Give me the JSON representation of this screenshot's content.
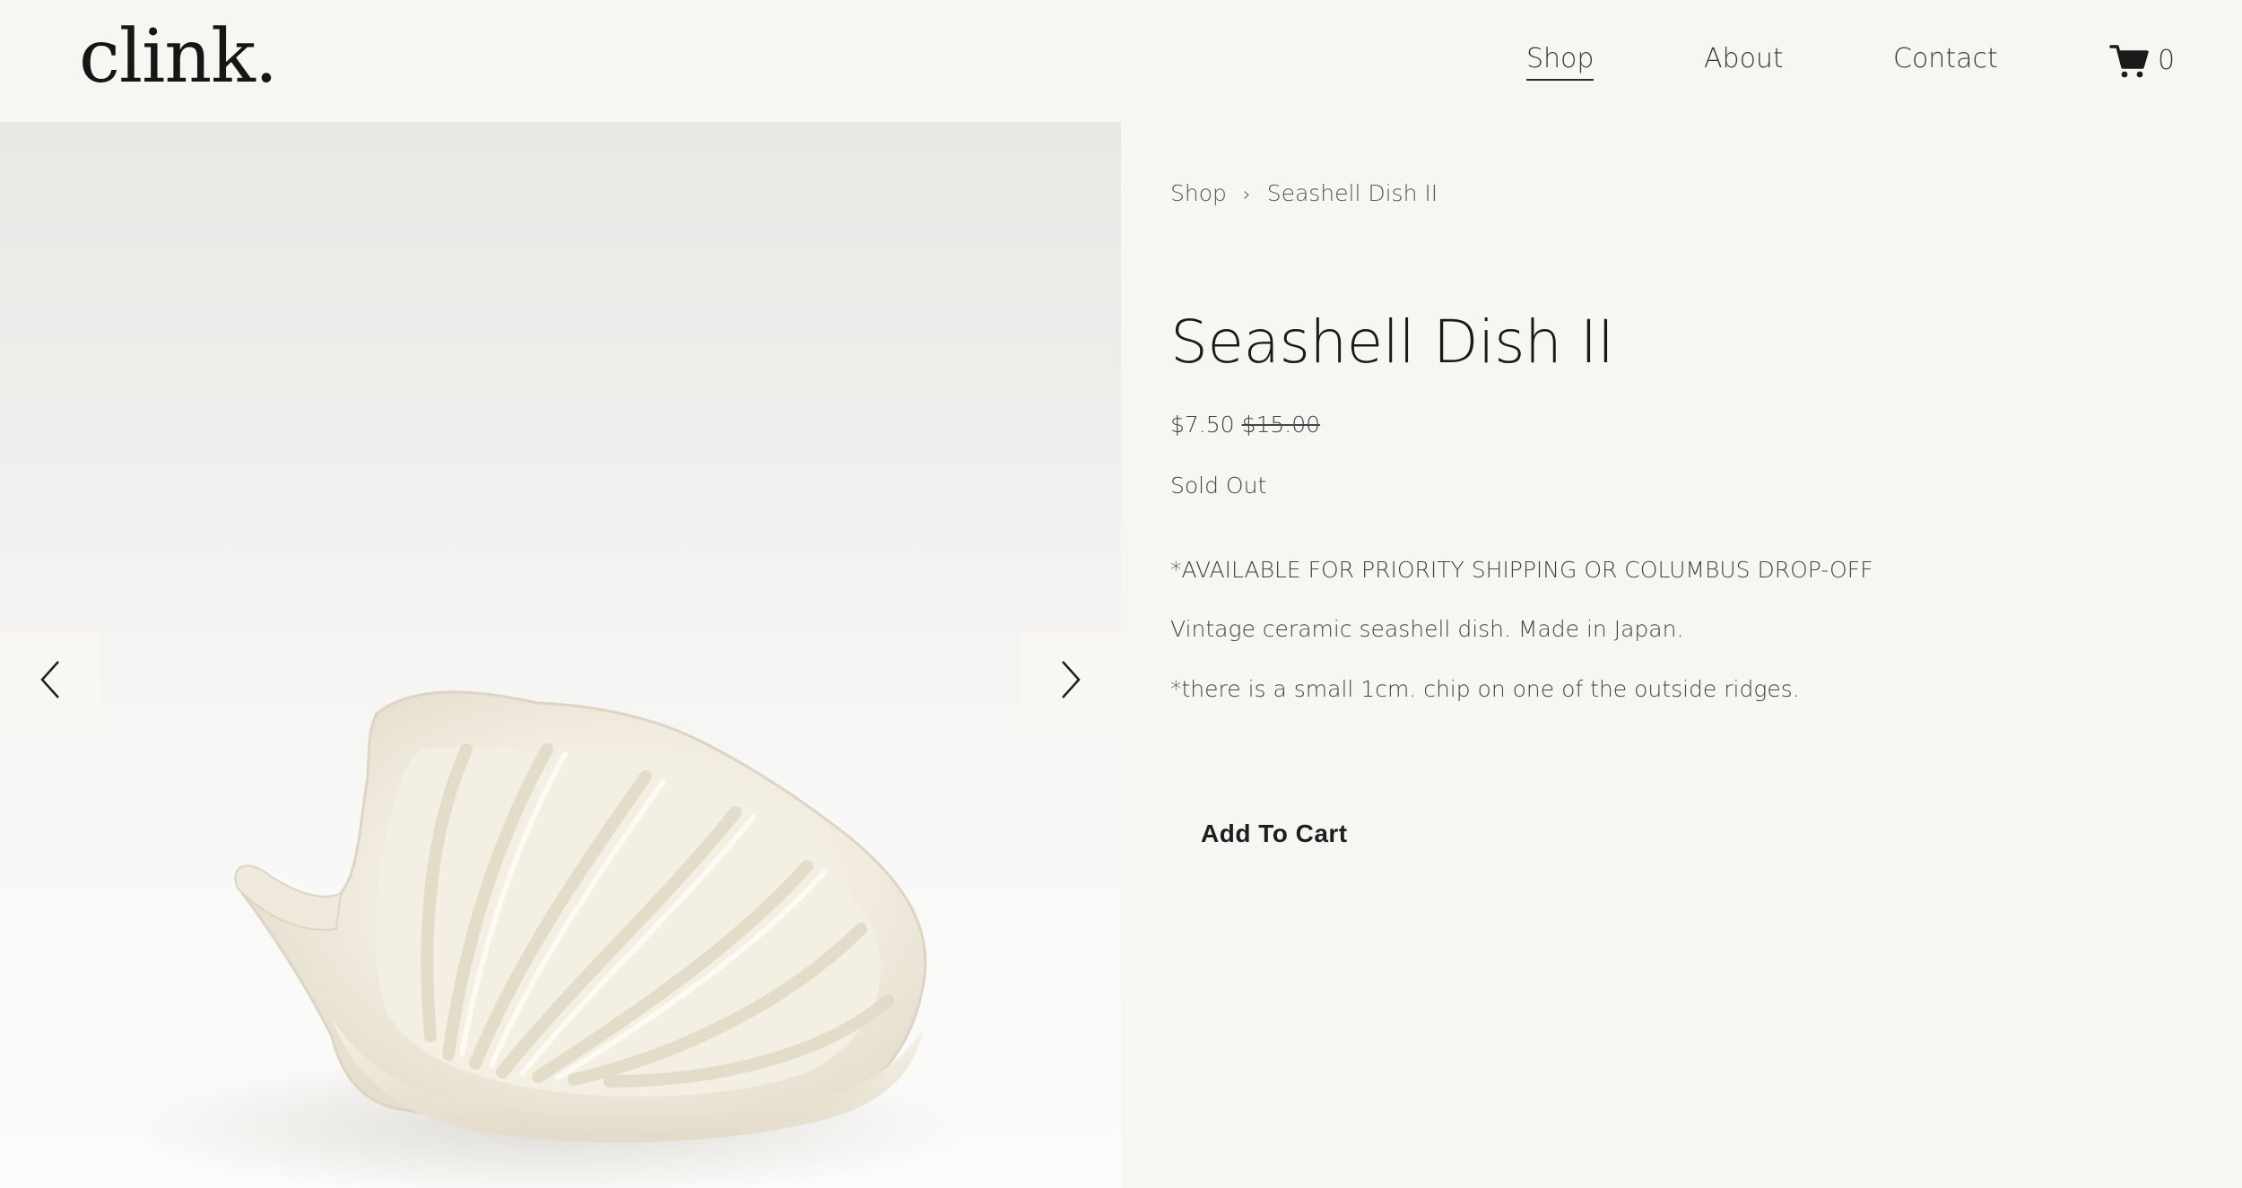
{
  "brand": {
    "logo_text": "clink."
  },
  "nav": {
    "items": [
      {
        "label": "Shop",
        "active": true
      },
      {
        "label": "About",
        "active": false
      },
      {
        "label": "Contact",
        "active": false
      }
    ],
    "cart_icon": "shopping-cart-icon",
    "cart_count": "0"
  },
  "gallery": {
    "prev_icon": "chevron-left-icon",
    "next_icon": "chevron-right-icon"
  },
  "breadcrumb": {
    "items": [
      "Shop",
      "Seashell Dish II"
    ],
    "separator": "›"
  },
  "product": {
    "title": "Seashell Dish II",
    "price": "$7.50",
    "original_price": "$15.00",
    "status": "Sold Out",
    "description": [
      "*AVAILABLE FOR PRIORITY SHIPPING OR COLUMBUS DROP-OFF",
      "Vintage ceramic seashell dish. Made in Japan.",
      "*there is a small 1cm. chip on one of the outside ridges."
    ],
    "add_to_cart_label": "Add To Cart"
  },
  "colors": {
    "background": "#f8f6f2",
    "text": "#1e1e1e",
    "muted_text": "#444444"
  }
}
